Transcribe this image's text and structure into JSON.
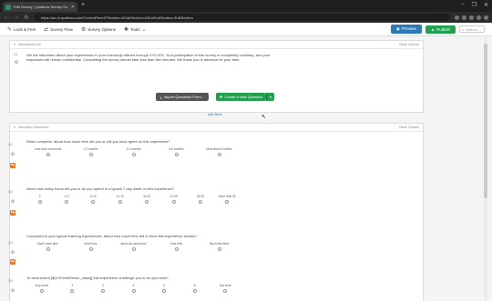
{
  "browser": {
    "tab_title": "Edit Survey | Qualtrics Survey So...",
    "new_tab": "+",
    "url": "https://au.ol.qualtrics.com/ControlPanel/?Section=&SubSection=&SubSubSection=EditSection",
    "window_controls": [
      "–",
      "❐",
      "✕"
    ]
  },
  "toolbar": {
    "look_feel": "Look & Feel",
    "survey_flow": "Survey Flow",
    "survey_options": "Survey Options",
    "tools": "Tools",
    "preview": "Preview",
    "publish": "Publish",
    "search_placeholder": "Search..."
  },
  "block1": {
    "title": "Introductory Info",
    "options": "Block Options",
    "qid": "Q1",
    "text": "We are interested about your experiences in your internship offered through XYZ-001. Your participation in this survey is completely voluntary, and your responses will remain confidential. Completing the survey should take less than five minutes. We thank you in advance for your time.",
    "import_label": "Import Questions From...",
    "create_label": "Create a New Question",
    "add_block": "Add Block"
  },
  "block2": {
    "title": "Internship Experience",
    "options": "Block Options",
    "questions": [
      {
        "qid": "Q2",
        "text": "When complete, about how much time did you or will you have spent on this experience?",
        "choices": [
          "Less than one month",
          "1-2 months",
          "3-4 months",
          "5-6 months",
          "More than 6 months"
        ]
      },
      {
        "qid": "Q3",
        "text": "About how many hours did you or do you spend in a typical 7-day week on this experience?",
        "choices": [
          "0",
          "1-5",
          "6-10",
          "11-15",
          "16-20",
          "21-25",
          "26-30",
          "More than 30"
        ]
      },
      {
        "qid": "Q4",
        "text": "Compared to your typical learning experiences, about how much time did or does this experience require?",
        "choices": [
          "Much more time",
          "More time",
          "About as much time",
          "Less time",
          "Much less time"
        ]
      },
      {
        "qid": "Q5",
        "text": "To what extent [${e://Field/Senior_class}] this experience challenge you to do your best?",
        "choices": [
          "Very much",
          "2",
          "3",
          "4",
          "5",
          "6",
          "Not at all"
        ]
      }
    ]
  }
}
